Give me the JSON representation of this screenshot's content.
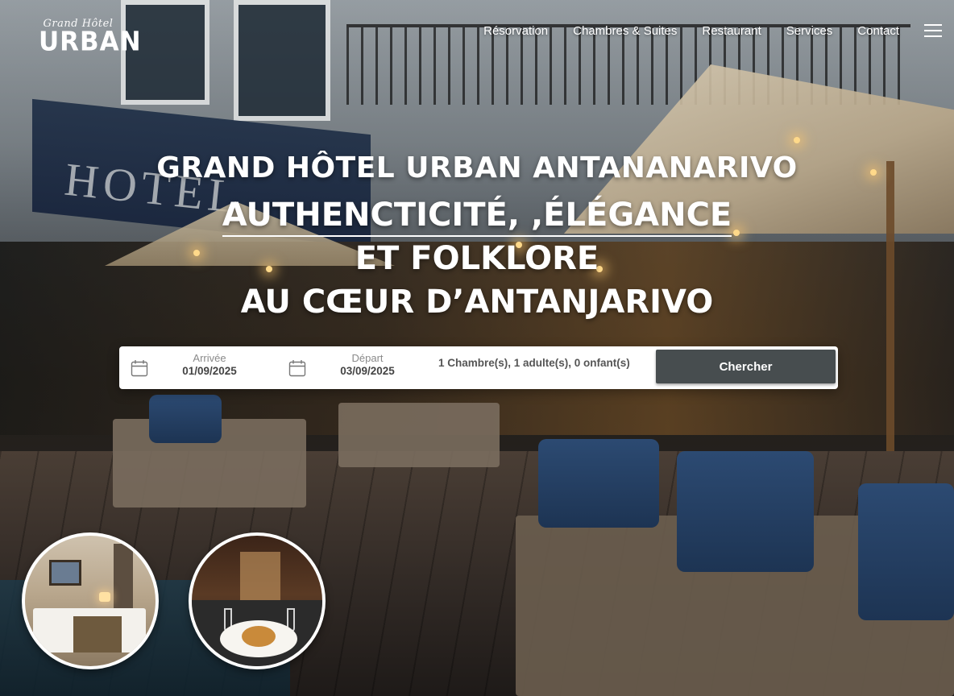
{
  "brand": {
    "script": "Grand Hôtel",
    "name": "URBAN"
  },
  "nav": {
    "items": [
      {
        "label": "Résorvation"
      },
      {
        "label": "Chambres & Suites"
      },
      {
        "label": "Restaurant"
      },
      {
        "label": "Services"
      },
      {
        "label": "Contact"
      }
    ],
    "menu_icon": "hamburger-menu-icon"
  },
  "hero": {
    "line1": "GRAND HÔTEL URBAN ANTANANARIVO",
    "line2": "AUTHENCTICITÉ, ,ÉLÉGANCE",
    "line3": "ET FOLKLORE",
    "line4": "AU CŒUR D’ANTANJARIVO",
    "background_text": "HOTEL"
  },
  "booking": {
    "arrival": {
      "label": "Arrivée",
      "value": "01/09/2025",
      "icon": "calendar-icon"
    },
    "departure": {
      "label": "Départ",
      "value": "03/09/2025",
      "icon": "calendar-icon"
    },
    "guests": "1 Chambre(s), 1 adulte(s), 0 onfant(s)",
    "search_label": "Chercher",
    "button_color": "#474d4f"
  },
  "thumbnails": [
    {
      "name": "room-thumbnail"
    },
    {
      "name": "restaurant-thumbnail"
    }
  ]
}
